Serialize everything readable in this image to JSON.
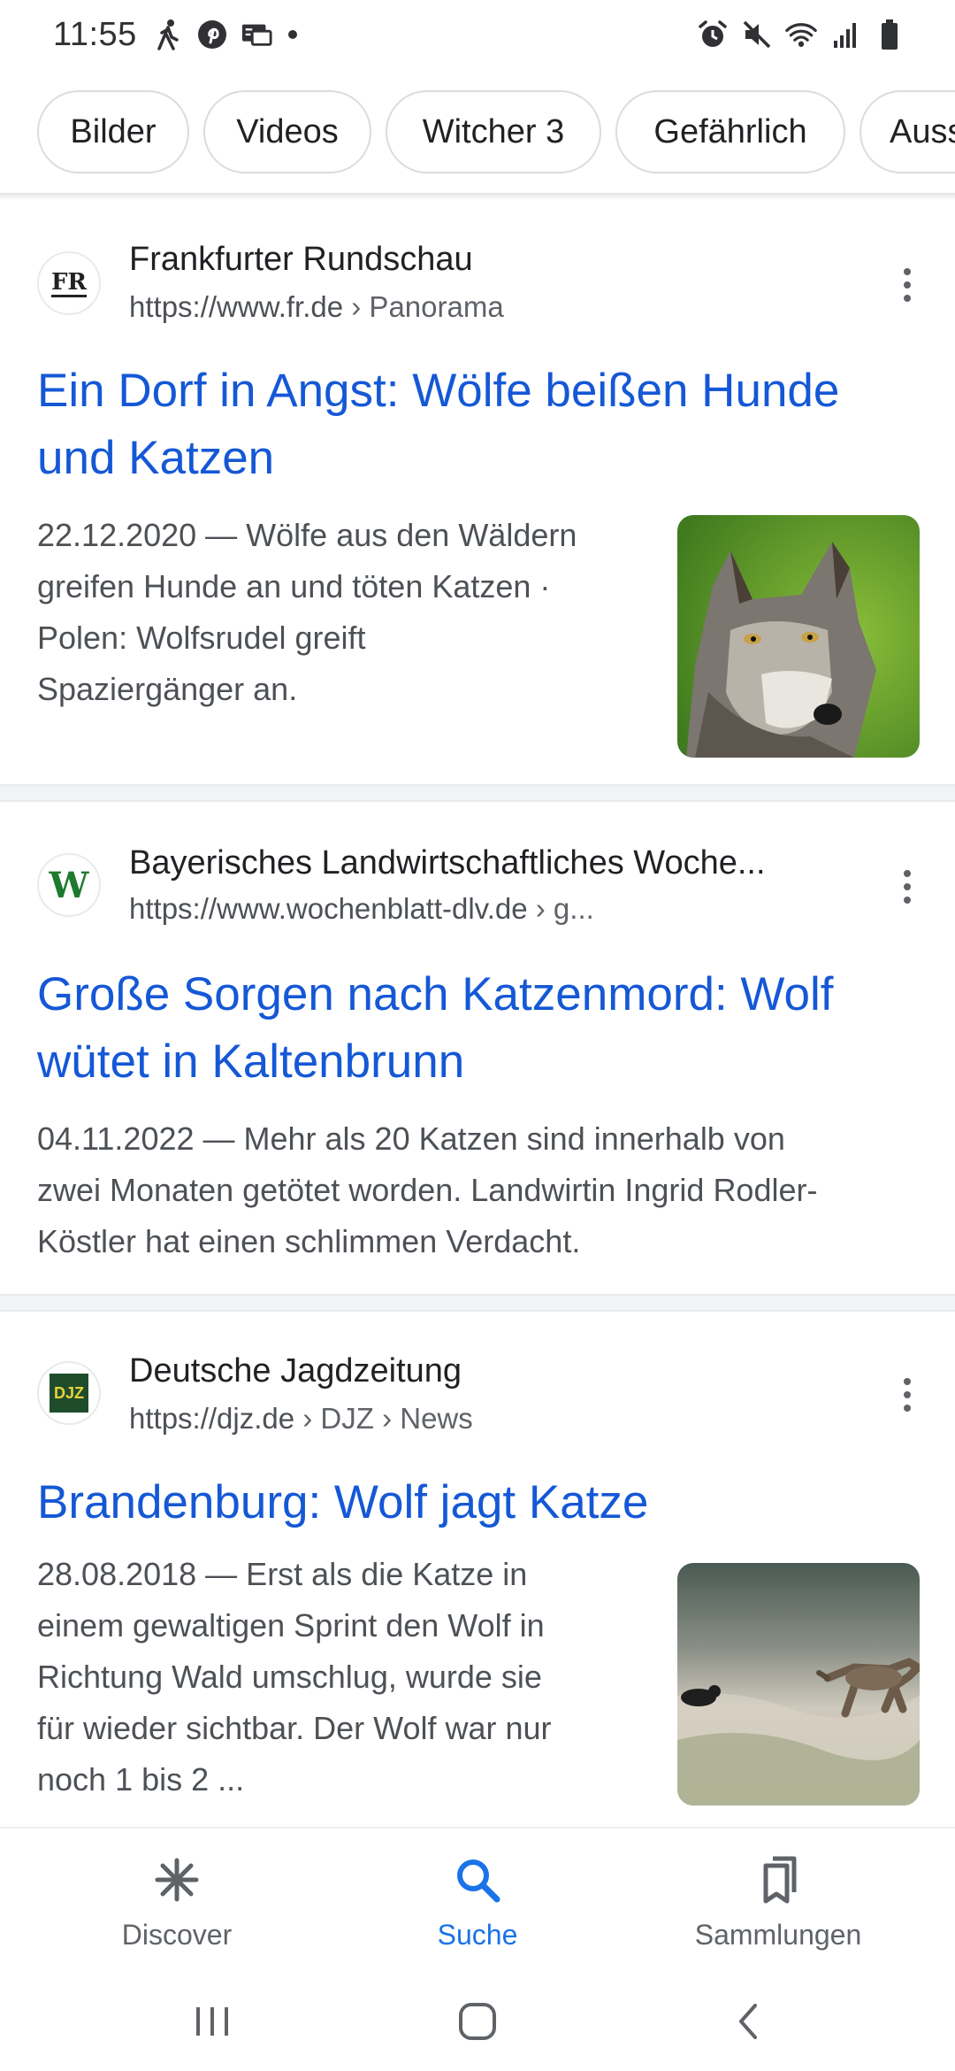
{
  "status_bar": {
    "time": "11:55",
    "left_icons": [
      "walking-icon",
      "pinterest-icon",
      "cast-icon",
      "dot"
    ],
    "right_icons": [
      "alarm-icon",
      "mute-icon",
      "wifi-icon",
      "signal-icon",
      "battery-icon"
    ]
  },
  "chips": [
    "Bilder",
    "Videos",
    "Witcher 3",
    "Gefährlich",
    "Auss"
  ],
  "results": [
    {
      "site_name": "Frankfurter Rundschau",
      "url_base": "https://www.fr.de",
      "url_path": " › Panorama",
      "favicon_text": "FR",
      "title_line1": "Ein Dorf in Angst: Wölfe beißen Hunde",
      "title_line2": "und Katzen",
      "snippet_lines": [
        "22.12.2020 — Wölfe aus den Wäldern",
        "greifen Hunde an und töten Katzen ·",
        "Polen: Wolfsrudel greift",
        "Spaziergänger an."
      ],
      "thumbnail": "wolf-portrait"
    },
    {
      "site_name": "Bayerisches Landwirtschaftliches Woche...",
      "url_base": "https://www.wochenblatt-dlv.de",
      "url_path": " › g...",
      "favicon_text": "W",
      "title_line1": "Große Sorgen nach Katzenmord: Wolf",
      "title_line2": "wütet in Kaltenbrunn",
      "snippet_lines": [
        "04.11.2022 — Mehr als 20 Katzen sind innerhalb von",
        "zwei Monaten getötet worden. Landwirtin Ingrid Rodler-",
        "Köstler hat einen schlimmen Verdacht."
      ]
    },
    {
      "site_name": "Deutsche Jagdzeitung",
      "url_base": "https://djz.de",
      "url_path": " › DJZ › News",
      "favicon_text": "DJZ",
      "title_line1": "Brandenburg: Wolf jagt Katze",
      "snippet_lines": [
        "28.08.2018 — Erst als die Katze in",
        "einem gewaltigen Sprint den Wolf in",
        "Richtung Wald umschlug, wurde sie",
        "für wieder sichtbar. Der Wolf war nur",
        "noch 1 bis 2 ..."
      ],
      "thumbnail": "wolf-chasing-cat"
    }
  ],
  "bottom_nav": {
    "discover": "Discover",
    "search": "Suche",
    "collections": "Sammlungen",
    "active": "search"
  },
  "colors": {
    "link": "#1558d6",
    "active_nav": "#1a73e8",
    "text_secondary": "#4d5156"
  }
}
